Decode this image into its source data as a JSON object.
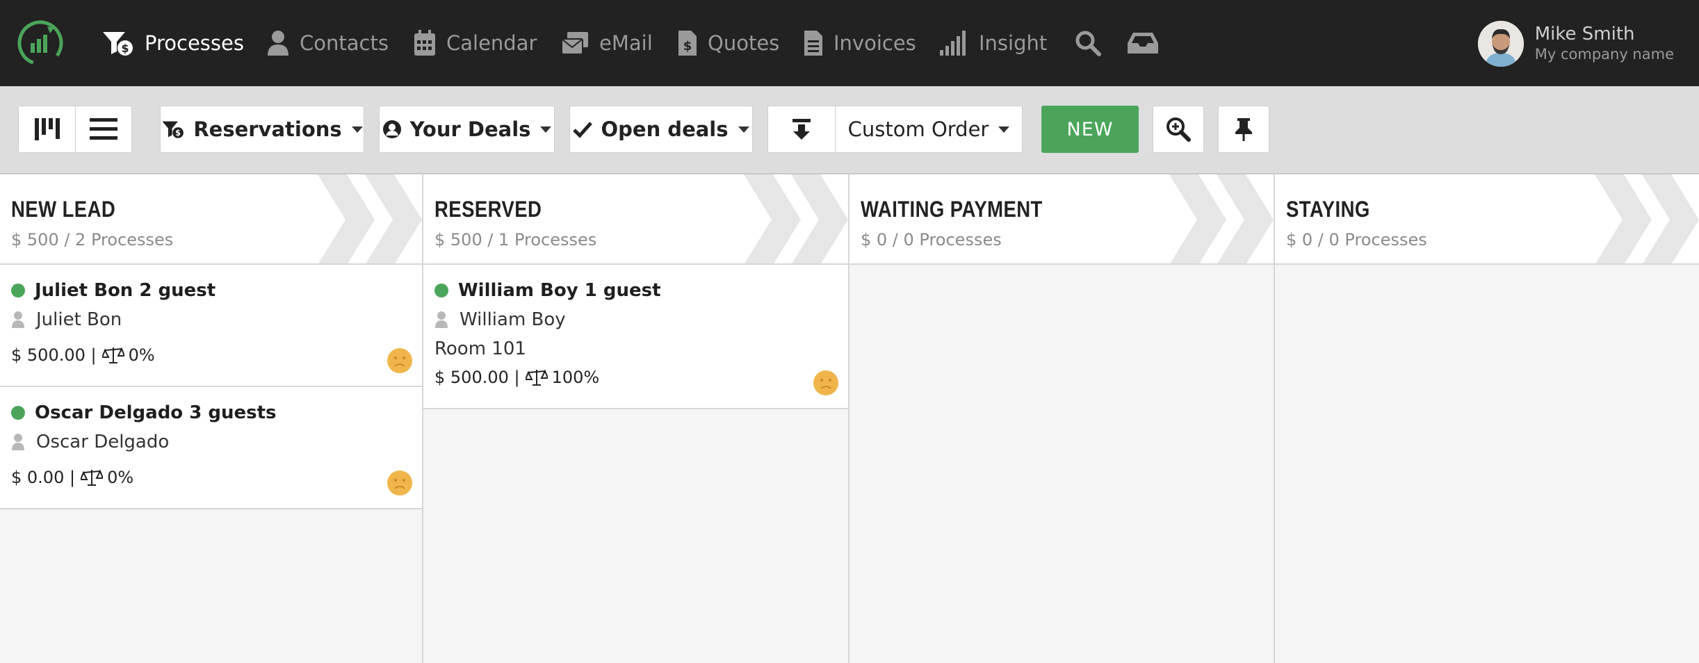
{
  "nav": {
    "items": [
      {
        "label": "Processes",
        "icon": "filter-dollar-icon"
      },
      {
        "label": "Contacts",
        "icon": "person-icon"
      },
      {
        "label": "Calendar",
        "icon": "calendar-icon"
      },
      {
        "label": "eMail",
        "icon": "mail-stack-icon"
      },
      {
        "label": "Quotes",
        "icon": "quote-file-icon"
      },
      {
        "label": "Invoices",
        "icon": "invoice-file-icon"
      },
      {
        "label": "Insight",
        "icon": "signal-bars-icon"
      }
    ],
    "active": "Processes"
  },
  "user": {
    "name": "Mike Smith",
    "company": "My company name"
  },
  "toolbar": {
    "pipeline": "Reservations",
    "owner": "Your Deals",
    "status": "Open deals",
    "order": "Custom Order",
    "new_label": "NEW"
  },
  "colors": {
    "accent": "#4aa55a",
    "topbar": "#222222",
    "smiley": "#f0b54a"
  },
  "columns": [
    {
      "title": "NEW LEAD",
      "summary": "$ 500 / 2 Processes"
    },
    {
      "title": "RESERVED",
      "summary": "$ 500 / 1 Processes"
    },
    {
      "title": "WAITING PAYMENT",
      "summary": "$ 0 / 0 Processes"
    },
    {
      "title": "STAYING",
      "summary": "$ 0 / 0 Processes"
    }
  ],
  "cards": {
    "c1": {
      "title": "Juliet Bon 2 guest",
      "contact": "Juliet Bon",
      "amount": "$ 500.00 |",
      "probability": "0%"
    },
    "c2": {
      "title": "Oscar Delgado 3 guests",
      "contact": "Oscar Delgado",
      "amount": "$ 0.00 |",
      "probability": "0%"
    },
    "c3": {
      "title": "William Boy 1 guest",
      "contact": "William Boy",
      "extra": "Room 101",
      "amount": "$ 500.00 |",
      "probability": "100%"
    }
  }
}
